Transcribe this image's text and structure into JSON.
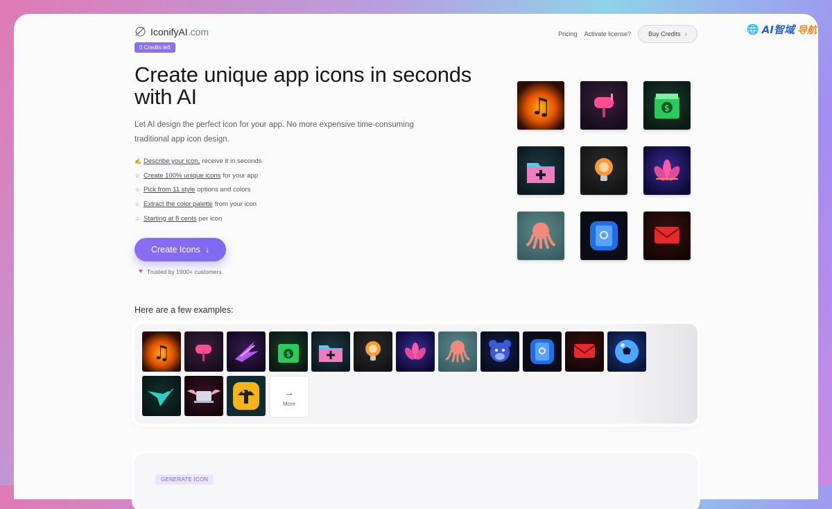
{
  "watermark": {
    "text": "AI智域",
    "text2": "导航"
  },
  "header": {
    "logo_name": "IconifyAI",
    "logo_domain": ".com",
    "credits_badge": "0 Credits left",
    "nav": {
      "pricing": "Pricing",
      "activate": "Activate license?",
      "buy": "Buy Credits"
    }
  },
  "hero": {
    "title": "Create unique app icons in seconds with AI",
    "subtitle": "Let AI design the perfect icon for your app. No more expensive time-consuming traditional app icon design.",
    "features": [
      {
        "icon": "✍",
        "link": "Describe your icon,",
        "rest": " receive it in seconds"
      },
      {
        "icon": "☺",
        "link": "Create 100% unique icons",
        "rest": " for your app"
      },
      {
        "icon": "☺",
        "link": "Pick from 11 style",
        "rest": " options and colors"
      },
      {
        "icon": "☺",
        "link": "Extract the color palette",
        "rest": " from your icon"
      },
      {
        "icon": "☺",
        "link": "Starting at 8 cents",
        "rest": " per icon"
      }
    ],
    "cta": "Create Icons",
    "trusted": "Trusted by 1900+ customers."
  },
  "showcase_icons": [
    "music-flame-icon",
    "mailbox-icon",
    "money-book-icon",
    "folder-plus-icon",
    "lightbulb-icon",
    "lotus-icon",
    "octopus-icon",
    "app-store-icon",
    "envelope-icon"
  ],
  "examples": {
    "title": "Here are a few examples:",
    "icons": [
      "music-flame-icon",
      "mailbox-icon",
      "hummingbird-icon",
      "money-book-icon",
      "folder-plus-icon",
      "lightbulb-icon",
      "lotus-icon",
      "octopus-icon",
      "bear-icon",
      "app-store-icon",
      "envelope-icon",
      "soccer-ball-icon",
      "bird-icon",
      "winged-laptop-icon",
      "mushroom-icon"
    ],
    "more_label": "More"
  },
  "generate": {
    "badge": "GENERATE ICON"
  },
  "colors": {
    "accent": "#8a6cf2",
    "badge_bg": "#8c6ff0"
  }
}
